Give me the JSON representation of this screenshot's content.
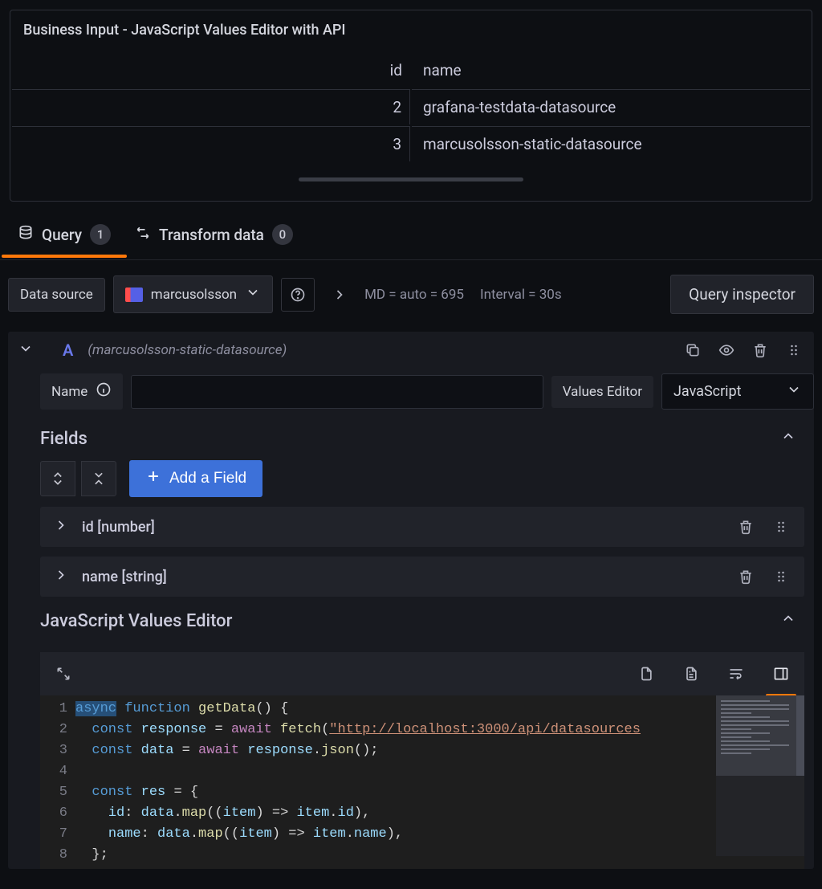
{
  "panel": {
    "title": "Business Input - JavaScript Values Editor with API",
    "columns": {
      "id": "id",
      "name": "name"
    },
    "rows": [
      {
        "id": "2",
        "name": "grafana-testdata-datasource"
      },
      {
        "id": "3",
        "name": "marcusolsson-static-datasource"
      }
    ]
  },
  "tabs": {
    "query": {
      "label": "Query",
      "badge": "1"
    },
    "transform": {
      "label": "Transform data",
      "badge": "0"
    }
  },
  "toolbar": {
    "datasource_label": "Data source",
    "datasource_value": "marcusolsson",
    "md_text": "MD = auto = 695",
    "interval_text": "Interval = 30s",
    "inspector_label": "Query inspector"
  },
  "query": {
    "ref": "A",
    "ds_name": "(marcusolsson-static-datasource)",
    "name_label": "Name",
    "values_editor_label": "Values Editor",
    "values_editor_value": "JavaScript"
  },
  "fields": {
    "section_label": "Fields",
    "add_label": "Add a Field",
    "items": [
      {
        "label": "id [number]"
      },
      {
        "label": "name [string]"
      }
    ]
  },
  "jsEditor": {
    "section_label": "JavaScript Values Editor",
    "lineNumbers": [
      "1",
      "2",
      "3",
      "4",
      "5",
      "6",
      "7",
      "8"
    ],
    "code": {
      "l1": {
        "a": "async",
        "b": "function",
        "c": "getData",
        "d": "() {"
      },
      "l2": {
        "a": "const",
        "b": "response",
        "c": "=",
        "d": "await",
        "e": "fetch",
        "f": "(",
        "g": "\"http://localhost:3000/api/datasources"
      },
      "l3": {
        "a": "const",
        "b": "data",
        "c": "=",
        "d": "await",
        "e": "response",
        "f": ".",
        "g": "json",
        "h": "();"
      },
      "l5": {
        "a": "const",
        "b": "res",
        "c": "= {"
      },
      "l6": {
        "a": "id",
        "b": ": ",
        "c": "data",
        "d": ".",
        "e": "map",
        "f": "((",
        "g": "item",
        "h": ") => ",
        "i": "item",
        "j": ".",
        "k": "id",
        "l": "),"
      },
      "l7": {
        "a": "name",
        "b": ": ",
        "c": "data",
        "d": ".",
        "e": "map",
        "f": "((",
        "g": "item",
        "h": ") => ",
        "i": "item",
        "j": ".",
        "k": "name",
        "l": "),"
      },
      "l8": {
        "a": "};"
      }
    }
  }
}
